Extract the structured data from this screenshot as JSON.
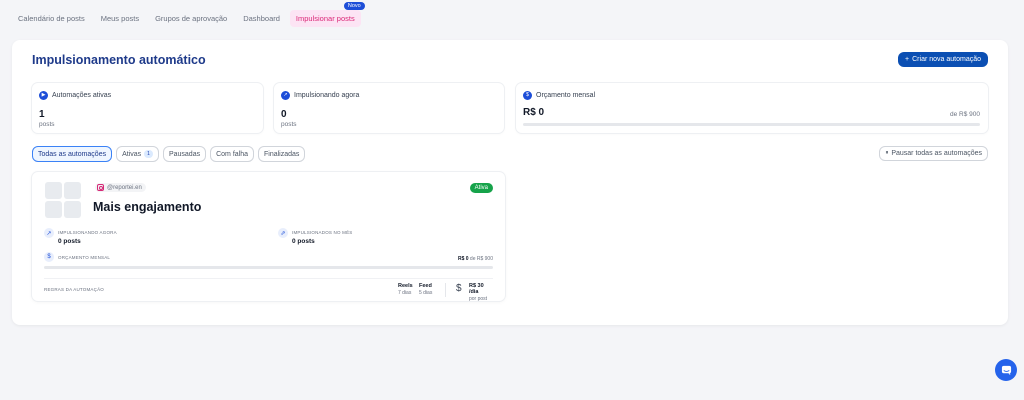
{
  "nav": {
    "tabs": [
      {
        "label": "Calendário de posts"
      },
      {
        "label": "Meus posts"
      },
      {
        "label": "Grupos de aprovação"
      },
      {
        "label": "Dashboard"
      },
      {
        "label": "Impulsionar posts",
        "badge": "Novo",
        "active": true
      }
    ]
  },
  "page": {
    "title": "Impulsionamento automático",
    "create_button": "Criar nova automação"
  },
  "stats": [
    {
      "label": "Automações ativas",
      "value": "1",
      "unit": "posts",
      "icon": "play-icon"
    },
    {
      "label": "Impulsionando agora",
      "value": "0",
      "unit": "posts",
      "icon": "trend-icon"
    },
    {
      "label": "Orçamento mensal",
      "value": "R$ 0",
      "of": "de R$ 900",
      "progress": 0,
      "icon": "dollar-icon"
    }
  ],
  "filters": [
    {
      "label": "Todas as automações",
      "active": true
    },
    {
      "label": "Ativas",
      "count": "1"
    },
    {
      "label": "Pausadas"
    },
    {
      "label": "Com falha"
    },
    {
      "label": "Finalizadas"
    }
  ],
  "pause_all": "Pausar todas as automações",
  "card": {
    "account": "@reportei.en",
    "status": "Ativa",
    "name": "Mais engajamento",
    "boosting_now_label": "IMPULSIONANDO AGORA",
    "boosting_now_value": "0 posts",
    "boosted_month_label": "IMPULSIONADOS NO MÊS",
    "boosted_month_value": "0 posts",
    "budget_label": "ORÇAMENTO MENSAL",
    "budget_spent": "R$ 0",
    "budget_total": "de R$ 900",
    "budget_progress": 0,
    "rules_label": "REGRAS DA AUTOMAÇÃO",
    "rules": [
      {
        "name": "Reels",
        "value": "7 dias"
      },
      {
        "name": "Feed",
        "value": "5 dias"
      }
    ],
    "spend_value": "R$ 30 /dia",
    "spend_unit": "por post"
  },
  "colors": {
    "primary": "#0b4fb3",
    "accent_pink": "#db2777",
    "success": "#16a34a",
    "chat": "#2563eb"
  }
}
